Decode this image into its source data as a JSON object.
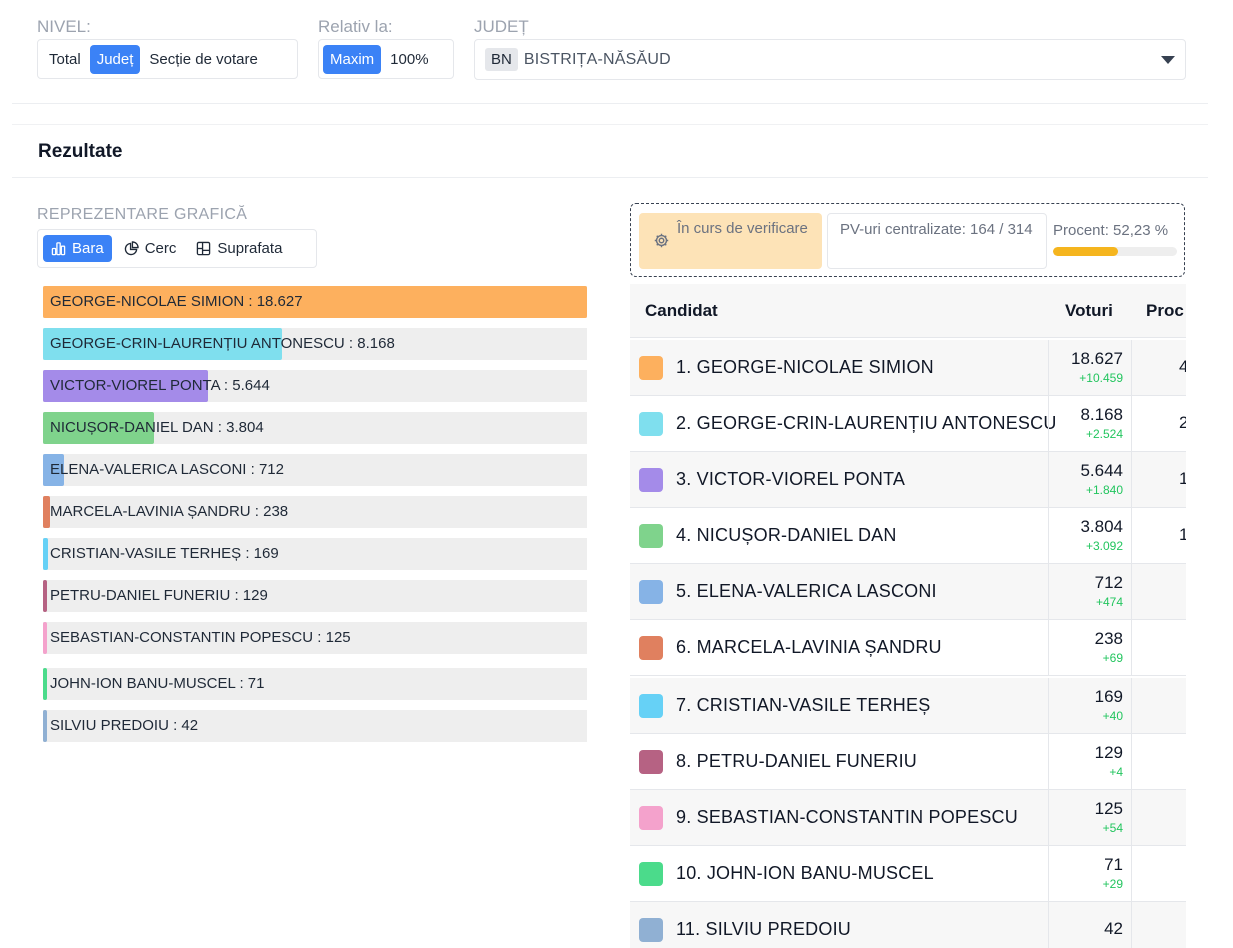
{
  "filters": {
    "nivel_label": "NIVEL:",
    "nivel_options": [
      "Total",
      "Județ",
      "Secție de votare"
    ],
    "relativ_label": "Relativ la:",
    "relativ_options": [
      "Maxim",
      "100%"
    ],
    "judet_label": "JUDEȚ",
    "judet_code": "BN",
    "judet_name": "BISTRIȚA-NĂSĂUD"
  },
  "results": {
    "title": "Rezultate",
    "graph_label": "REPREZENTARE GRAFICĂ",
    "chart_types": [
      "Bara",
      "Cerc",
      "Suprafata"
    ]
  },
  "status": {
    "verification": "În curs de verificare",
    "pv": "PV-uri centralizate: 164 / 314",
    "procent": "Procent: 52,23 %",
    "procent_value": 0.5223,
    "accent": "#f5b51e"
  },
  "table": {
    "headers": [
      "Candidat",
      "Voturi",
      "Proc"
    ]
  },
  "chart_data": {
    "type": "bar",
    "categories": [
      "GEORGE-NICOLAE SIMION",
      "GEORGE-CRIN-LAURENȚIU ANTONESCU",
      "VICTOR-VIOREL PONTA",
      "NICUȘOR-DANIEL DAN",
      "ELENA-VALERICA LASCONI",
      "MARCELA-LAVINIA ȘANDRU",
      "CRISTIAN-VASILE TERHEȘ",
      "PETRU-DANIEL FUNERIU",
      "SEBASTIAN-CONSTANTIN POPESCU",
      "JOHN-ION BANU-MUSCEL",
      "SILVIU PREDOIU"
    ],
    "values": [
      18627,
      8168,
      5644,
      3804,
      712,
      238,
      169,
      129,
      125,
      71,
      42
    ],
    "labels": [
      "GEORGE-NICOLAE SIMION : 18.627",
      "GEORGE-CRIN-LAURENȚIU ANTONESCU : 8.168",
      "VICTOR-VIOREL PONTA : 5.644",
      "NICUȘOR-DANIEL DAN : 3.804",
      "ELENA-VALERICA LASCONI : 712",
      "MARCELA-LAVINIA ȘANDRU : 238",
      "CRISTIAN-VASILE TERHEȘ : 169",
      "PETRU-DANIEL FUNERIU : 129",
      "SEBASTIAN-CONSTANTIN POPESCU : 125",
      "JOHN-ION BANU-MUSCEL : 71",
      "SILVIU PREDOIU : 42"
    ],
    "colors": [
      "#fdb05e",
      "#7fdfee",
      "#a48be9",
      "#7fd38c",
      "#86b3e6",
      "#e0805f",
      "#66d1f6",
      "#b66283",
      "#f4a2cc",
      "#4bdb8b",
      "#90b0d3"
    ],
    "max": 18627
  },
  "candidates": [
    {
      "name": "1. GEORGE-NICOLAE SIMION",
      "votes": "18.627",
      "delta": "+10.459",
      "pct": "4"
    },
    {
      "name": "2. GEORGE-CRIN-LAURENȚIU ANTONESCU",
      "votes": "8.168",
      "delta": "+2.524",
      "pct": "2"
    },
    {
      "name": "3. VICTOR-VIOREL PONTA",
      "votes": "5.644",
      "delta": "+1.840",
      "pct": "1"
    },
    {
      "name": "4. NICUȘOR-DANIEL DAN",
      "votes": "3.804",
      "delta": "+3.092",
      "pct": "1"
    },
    {
      "name": "5. ELENA-VALERICA LASCONI",
      "votes": "712",
      "delta": "+474",
      "pct": ""
    },
    {
      "name": "6. MARCELA-LAVINIA ȘANDRU",
      "votes": "238",
      "delta": "+69",
      "pct": ""
    },
    {
      "name": "7. CRISTIAN-VASILE TERHEȘ",
      "votes": "169",
      "delta": "+40",
      "pct": ""
    },
    {
      "name": "8. PETRU-DANIEL FUNERIU",
      "votes": "129",
      "delta": "+4",
      "pct": ""
    },
    {
      "name": "9. SEBASTIAN-CONSTANTIN POPESCU",
      "votes": "125",
      "delta": "+54",
      "pct": ""
    },
    {
      "name": "10. JOHN-ION BANU-MUSCEL",
      "votes": "71",
      "delta": "+29",
      "pct": ""
    },
    {
      "name": "11. SILVIU PREDOIU",
      "votes": "42",
      "delta": "",
      "pct": ""
    }
  ]
}
